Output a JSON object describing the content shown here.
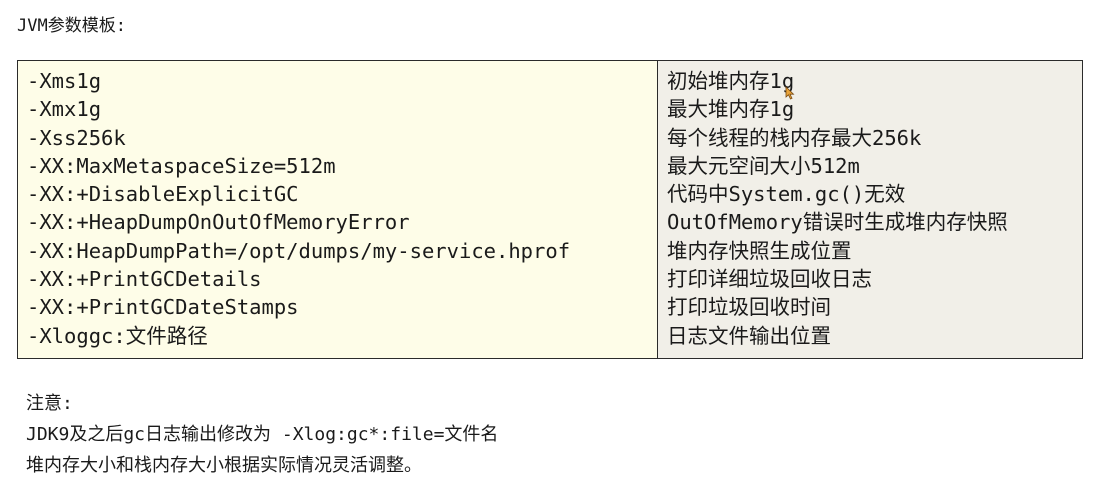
{
  "heading": "JVM参数模板:",
  "params": [
    {
      "option": "-Xms1g",
      "description": "初始堆内存1g"
    },
    {
      "option": "-Xmx1g",
      "description": "最大堆内存1g"
    },
    {
      "option": "-Xss256k",
      "description": "每个线程的栈内存最大256k"
    },
    {
      "option": "-XX:MaxMetaspaceSize=512m",
      "description": "最大元空间大小512m"
    },
    {
      "option": "-XX:+DisableExplicitGC",
      "description": "代码中System.gc()无效"
    },
    {
      "option": "-XX:+HeapDumpOnOutOfMemoryError",
      "description": "OutOfMemory错误时生成堆内存快照"
    },
    {
      "option": "-XX:HeapDumpPath=/opt/dumps/my-service.hprof",
      "description": "堆内存快照生成位置"
    },
    {
      "option": "-XX:+PrintGCDetails",
      "description": "打印详细垃圾回收日志"
    },
    {
      "option": "-XX:+PrintGCDateStamps",
      "description": "打印垃圾回收时间"
    },
    {
      "option": "-Xloggc:文件路径",
      "description": "日志文件输出位置"
    }
  ],
  "notes": {
    "title": "注意:",
    "line1": "JDK9及之后gc日志输出修改为 -Xlog:gc*:file=文件名",
    "line2": "堆内存大小和栈内存大小根据实际情况灵活调整。"
  },
  "colors": {
    "left_column_bg": "#fefde8",
    "right_column_bg": "#f1efe8",
    "border": "#2b2b2b"
  },
  "icons": {
    "cursor": "mouse-pointer-icon"
  }
}
